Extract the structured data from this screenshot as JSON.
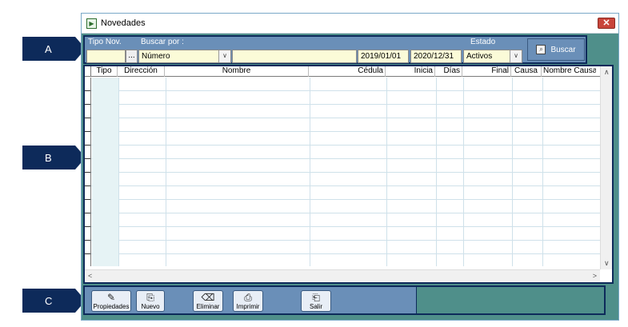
{
  "markers": {
    "a": "A",
    "b": "B",
    "c": "C"
  },
  "window": {
    "title": "Novedades",
    "close": "✕"
  },
  "filters": {
    "tipo_nov_label": "Tipo Nov.",
    "buscar_por_label": "Buscar por :",
    "buscar_por_value": "Número",
    "dots": "...",
    "fecha_inicio": "2019/01/01",
    "fecha_fin": "2020/12/31",
    "estado_label": "Estado",
    "estado_value": "Activos",
    "search_label": "Buscar"
  },
  "grid": {
    "columns": [
      "Tipo",
      "Dirección",
      "Nombre",
      "Cédula",
      "Inicia",
      "Días",
      "Final",
      "Causa",
      "Nombre Causa"
    ]
  },
  "toolbar": {
    "propiedades": "Propiedades",
    "nuevo": "Nuevo",
    "eliminar": "Eliminar",
    "imprimir": "Imprimir",
    "salir": "Salir"
  },
  "colors": {
    "marker": "#0d2a5a",
    "window_bg": "#4f8f8a",
    "panel_bg": "#6a8fb8",
    "field_bg": "#fbfbd8"
  }
}
